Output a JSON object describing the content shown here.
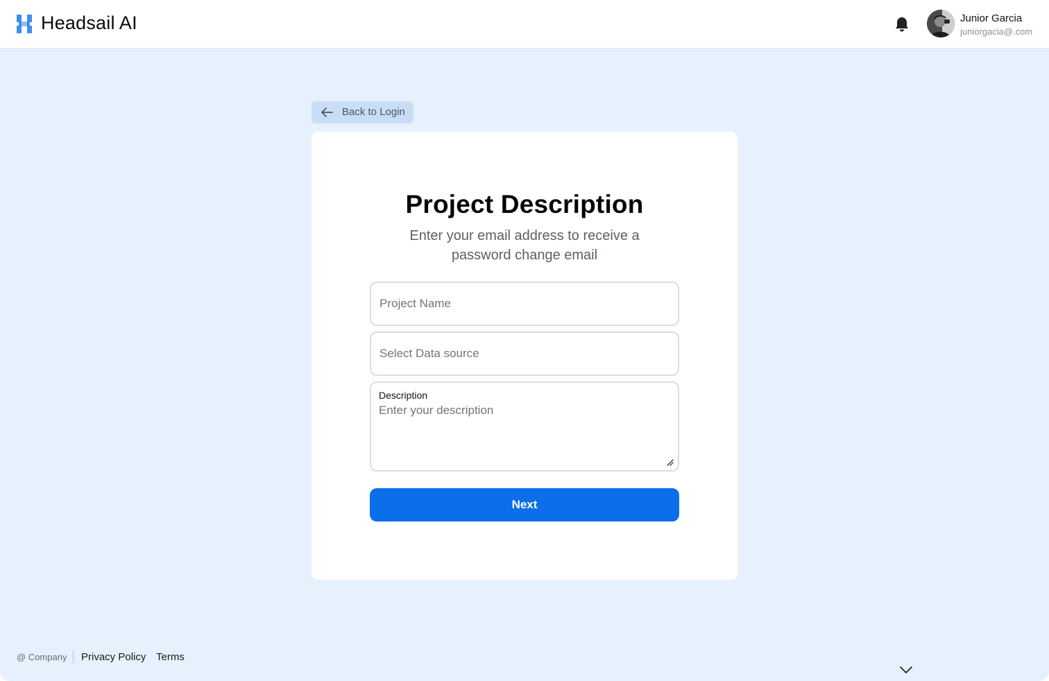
{
  "header": {
    "brand": "Headsail AI",
    "user": {
      "name": "Junior Garcia",
      "email": "juniorgacia@.com"
    }
  },
  "nav": {
    "back_label": "Back to Login"
  },
  "form": {
    "title": "Project Description",
    "subtitle": "Enter your email address to receive a password change email",
    "project_name": {
      "value": "",
      "placeholder": "Project Name"
    },
    "data_source": {
      "value": "",
      "placeholder": "Select Data source"
    },
    "description": {
      "label": "Description",
      "value": "",
      "placeholder": "Enter your description"
    },
    "submit_label": "Next"
  },
  "footer": {
    "copyright": "@ Company",
    "links": [
      {
        "label": "Privacy Policy"
      },
      {
        "label": "Terms"
      }
    ]
  },
  "colors": {
    "accent": "#0a6fe8",
    "logo": "#3d8ef0",
    "background": "#e6f1fd",
    "back_button_bg": "#c9def6"
  },
  "icons": {
    "logo": "headsail-logo-icon",
    "notifications": "bell-icon",
    "back": "arrow-left-icon",
    "scroll": "chevron-down-icon",
    "resize": "resize-handle-icon"
  }
}
